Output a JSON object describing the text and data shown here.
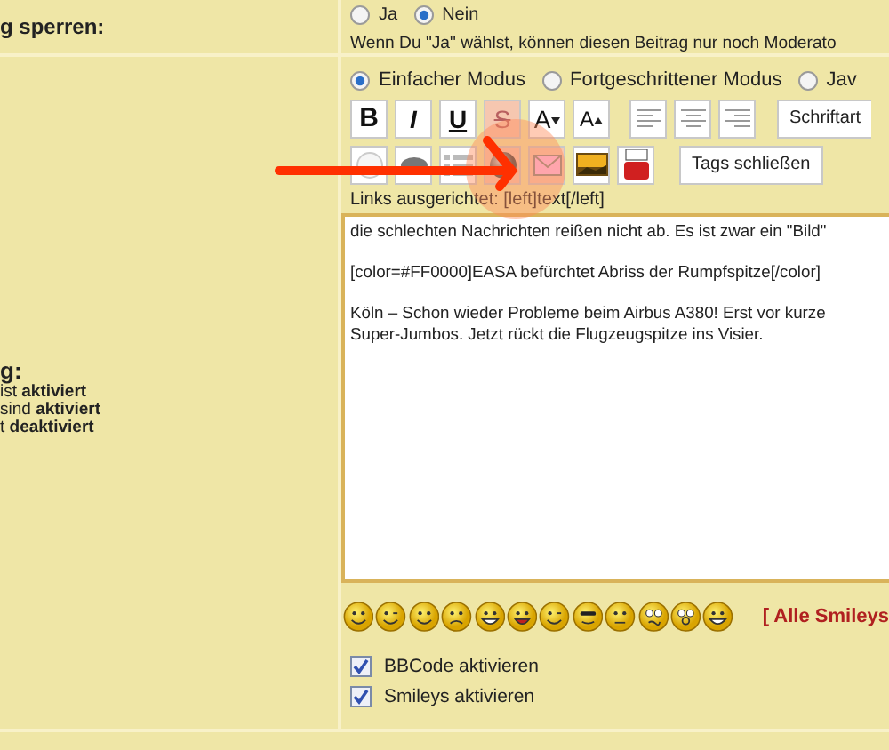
{
  "lock_row": {
    "label": "g sperren:",
    "options": [
      {
        "label": "Ja",
        "selected": false
      },
      {
        "label": "Nein",
        "selected": true
      }
    ],
    "hint": "Wenn Du \"Ja\" wählst, können diesen Beitrag nur noch Moderato"
  },
  "options_panel": {
    "heading": "g:",
    "lines": [
      "ist **aktiviert**",
      "sind **aktiviert**",
      "t **deaktiviert**"
    ]
  },
  "editor": {
    "modes": [
      {
        "label": "Einfacher Modus",
        "selected": true
      },
      {
        "label": "Fortgeschrittener Modus",
        "selected": false
      },
      {
        "label": "Jav",
        "selected": false
      }
    ],
    "format_buttons": [
      {
        "kind": "bold",
        "label": "B"
      },
      {
        "kind": "italic",
        "label": "I"
      },
      {
        "kind": "underline",
        "label": "U"
      },
      {
        "kind": "strike",
        "label": "S"
      },
      {
        "kind": "smaller",
        "label": "A"
      },
      {
        "kind": "bigger",
        "label": "A"
      },
      {
        "kind": "align-left"
      },
      {
        "kind": "align-center"
      },
      {
        "kind": "align-right"
      }
    ],
    "font_button": "Schriftart",
    "insert_buttons": [
      {
        "kind": "circle"
      },
      {
        "kind": "ellipse"
      },
      {
        "kind": "list"
      },
      {
        "kind": "sphere"
      },
      {
        "kind": "mail"
      },
      {
        "kind": "image"
      },
      {
        "kind": "video"
      }
    ],
    "close_tags_button": "Tags schließen",
    "help": "Links ausgerichtet: [left]text[/left]",
    "text": "die schlechten Nachrichten reißen nicht ab. Es ist zwar ein \"Bild\"\n\n[color=#FF0000]EASA befürchtet Abriss der Rumpfspitze[/color]\n\nKöln – Schon wieder Probleme beim Airbus A380! Erst vor kurze\nSuper-Jumbos. Jetzt rückt die Flugzeugspitze ins Visier.\n\n"
  },
  "smileys": [
    {
      "kind": "smile"
    },
    {
      "kind": "wink"
    },
    {
      "kind": "smile"
    },
    {
      "kind": "sad"
    },
    {
      "kind": "grin"
    },
    {
      "kind": "tongue"
    },
    {
      "kind": "wink"
    },
    {
      "kind": "cool"
    },
    {
      "kind": "flat"
    },
    {
      "kind": "confused"
    },
    {
      "kind": "eek"
    },
    {
      "kind": "grin"
    }
  ],
  "all_smileys_link": "[ Alle Smileys",
  "checkboxes": [
    {
      "label": "BBCode aktivieren",
      "checked": true
    },
    {
      "label": "Smileys aktivieren",
      "checked": true
    }
  ],
  "annotations": [
    {
      "kind": "highlight"
    },
    {
      "kind": "arrow"
    }
  ]
}
